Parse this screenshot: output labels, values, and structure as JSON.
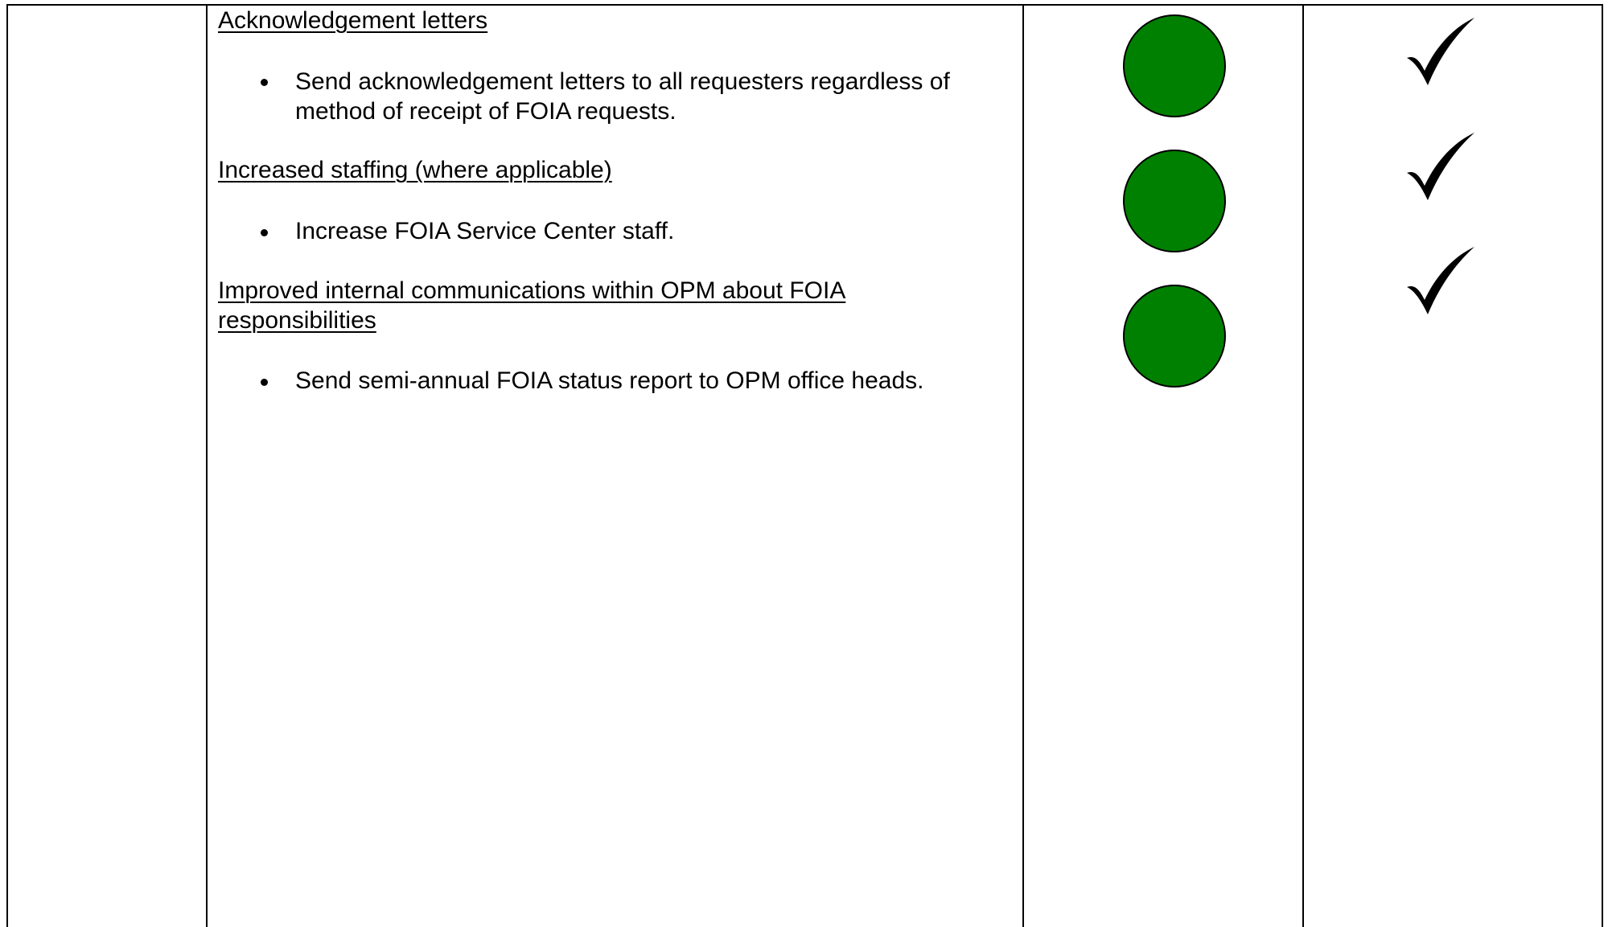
{
  "colors": {
    "status_green": "#008000",
    "border": "#000000"
  },
  "content": {
    "sections": [
      {
        "heading": "Acknowledgement letters",
        "bullet": "Send acknowledgement letters to all requesters regardless of method of receipt of FOIA requests."
      },
      {
        "heading": "Increased staffing (where applicable)",
        "bullet": "Increase FOIA Service Center staff."
      },
      {
        "heading": "Improved internal communications within OPM about FOIA responsibilities",
        "bullet": "Send semi-annual FOIA status report to OPM office heads."
      }
    ]
  },
  "status_icons": [
    "green-circle-icon",
    "green-circle-icon",
    "green-circle-icon"
  ],
  "completion_icons": [
    "checkmark-icon",
    "checkmark-icon",
    "checkmark-icon"
  ]
}
